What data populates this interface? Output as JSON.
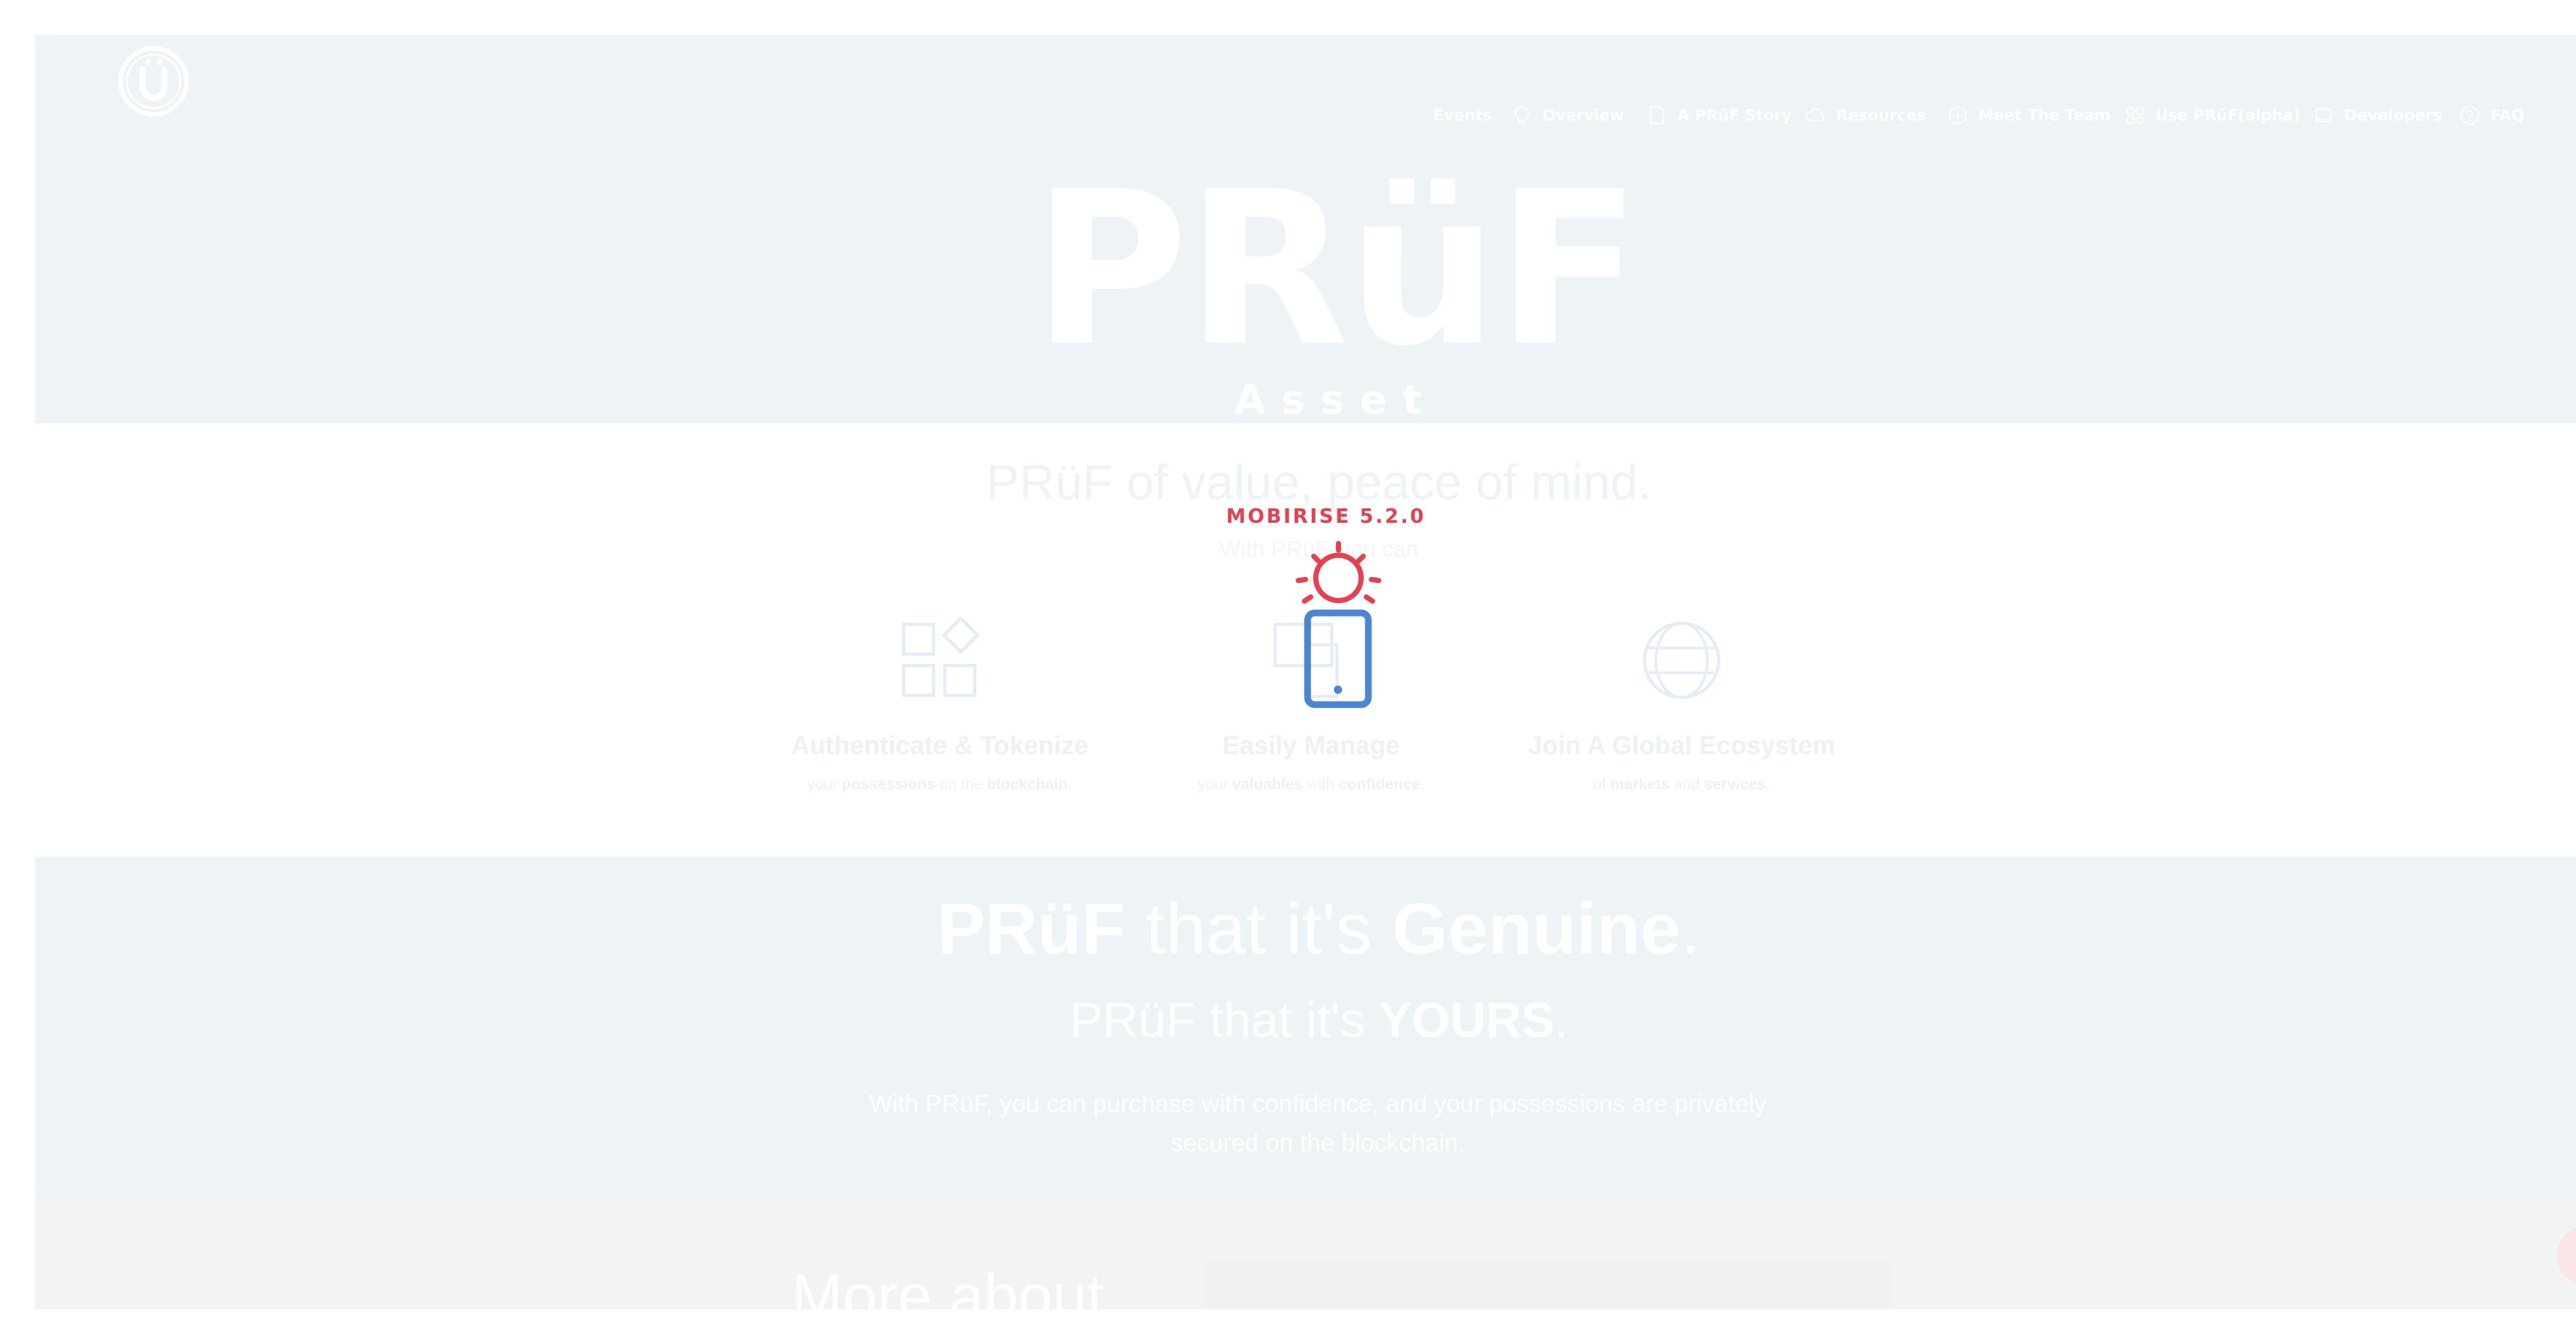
{
  "header": {
    "logo_icon": "pruf-u-logo-icon",
    "nav": [
      {
        "label": "Events",
        "icon": ""
      },
      {
        "label": "Overview",
        "icon": "lightbulb-icon"
      },
      {
        "label": "A PRüF Story",
        "icon": "book-icon"
      },
      {
        "label": "Resources",
        "icon": "cloud-icon"
      },
      {
        "label": "Meet The Team",
        "icon": "team-icon"
      },
      {
        "label": "Use PRüF(alpha)",
        "icon": "apps-icon"
      },
      {
        "label": "Developers",
        "icon": "laptop-icon"
      },
      {
        "label": "FAQ",
        "icon": "help-icon"
      }
    ]
  },
  "hero": {
    "brand_word": "PRüF",
    "brand_tagline": "Asset Provenance"
  },
  "features": {
    "tagline": "PRüF of value, peace of mind.",
    "subtitle": "With PRüF, you can",
    "items": [
      {
        "icon": "grid-icon",
        "title": "Authenticate & Tokenize",
        "desc_parts": [
          "your ",
          "possessions",
          " on the ",
          "blockchain",
          "."
        ]
      },
      {
        "icon": "devices-icon",
        "title": "Easily Manage",
        "desc_parts": [
          "your ",
          "valuables",
          " with ",
          "confidence",
          "."
        ]
      },
      {
        "icon": "globe-icon",
        "title": "Join A Global Ecosystem",
        "desc_parts": [
          "of ",
          "markets",
          " and ",
          "services",
          "."
        ]
      }
    ]
  },
  "genuine": {
    "line1_parts": [
      "PRüF",
      " that it's ",
      "Genuine",
      "."
    ],
    "line2_parts": [
      "PRüF that it's ",
      "YOURS",
      "."
    ],
    "body": "With PRüF, you can purchase with confidence, and your possessions are privately secured on the blockchain."
  },
  "more": {
    "title": "More about"
  },
  "overlay": {
    "title": "MOBIRISE  5.2.0",
    "icon": "phone-sun-icon",
    "accent_red": "#e8414d",
    "accent_blue": "#4a86d6"
  },
  "scroll_top": {
    "icon": "arrow-up-icon"
  },
  "colors": {
    "hero_bg": "#eef3f5",
    "feature_icon": "#e3ecf7"
  }
}
